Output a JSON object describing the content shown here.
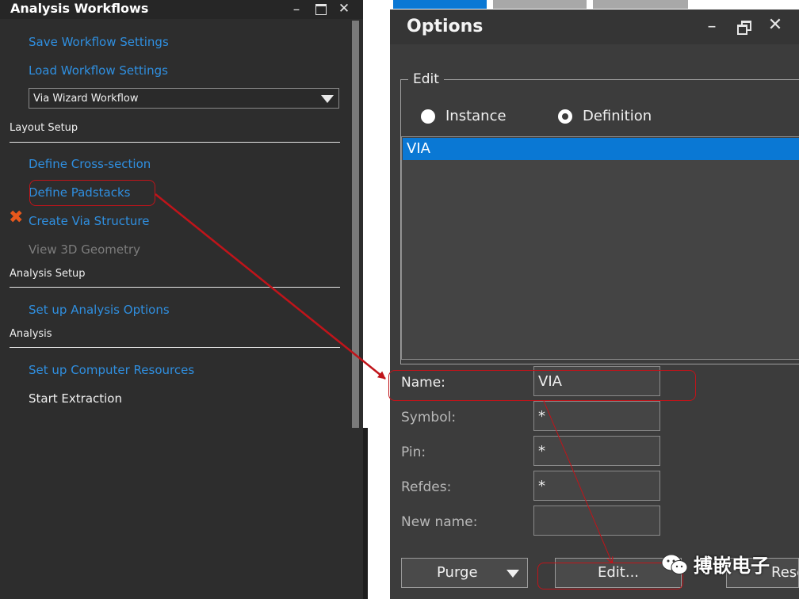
{
  "left_panel": {
    "title": "Analysis Workflows",
    "links": {
      "save": "Save Workflow Settings",
      "load": "Load Workflow Settings",
      "cross_section": "Define Cross-section",
      "padstacks": "Define Padstacks",
      "via_structure": "Create Via Structure",
      "view_3d": "View 3D Geometry",
      "analysis_options": "Set up Analysis Options",
      "computer_resources": "Set up Computer Resources",
      "start_extraction": "Start Extraction"
    },
    "workflow_select": "Via Wizard Workflow",
    "sections": {
      "layout": "Layout Setup",
      "analysis_setup": "Analysis Setup",
      "analysis": "Analysis"
    }
  },
  "right_panel": {
    "title": "Options",
    "group_label": "Edit",
    "radio_instance": "Instance",
    "radio_definition": "Definition",
    "radio_selected": "Definition",
    "list_items": [
      "VIA"
    ],
    "fields": {
      "name_label": "Name:",
      "name_value": "VIA",
      "symbol_label": "Symbol:",
      "symbol_value": "*",
      "pin_label": "Pin:",
      "pin_value": "*",
      "refdes_label": "Refdes:",
      "refdes_value": "*",
      "newname_label": "New name:",
      "newname_value": ""
    },
    "buttons": {
      "purge": "Purge",
      "edit": "Edit...",
      "reset": "Rese"
    }
  },
  "watermark": "搏嵌电子",
  "colors": {
    "link_blue": "#2f8fe0",
    "selection_blue": "#0a78d4",
    "annotation_red": "#c0141a",
    "error_x": "#e8581c"
  }
}
